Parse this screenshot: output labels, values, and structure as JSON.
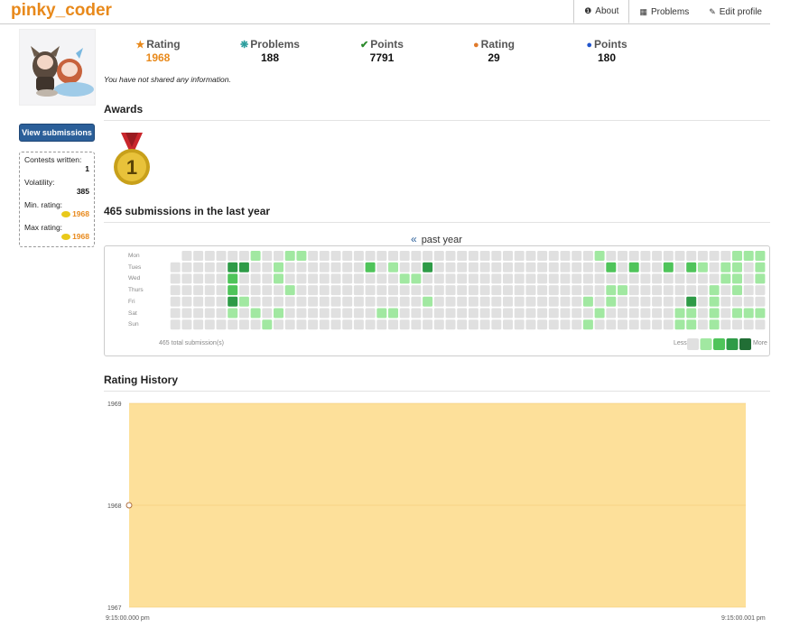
{
  "header": {
    "username": "pinky_coder",
    "tabs": [
      {
        "label": "About",
        "icon": "info-icon",
        "active": true
      },
      {
        "label": "Problems",
        "icon": "sitemap-icon",
        "active": false
      },
      {
        "label": "Edit profile",
        "icon": "edit-icon",
        "active": false
      }
    ]
  },
  "sidebar": {
    "view_submissions": "View submissions",
    "contests_label": "Contests written:",
    "contests_value": "1",
    "volatility_label": "Volatility:",
    "volatility_value": "385",
    "min_label": "Min. rating:",
    "min_value": "1968",
    "max_label": "Max rating:",
    "max_value": "1968"
  },
  "stats": [
    {
      "label": "Rating",
      "value": "1968",
      "icon": "star-icon",
      "icon_color": "#e8891b",
      "value_color": "#e8891b"
    },
    {
      "label": "Problems",
      "value": "188",
      "icon": "puzzle-icon",
      "icon_color": "#2a9d9d",
      "value_color": "#111"
    },
    {
      "label": "Points",
      "value": "7791",
      "icon": "check-icon",
      "icon_color": "#2b8a2b",
      "value_color": "#111"
    },
    {
      "label": "Rating",
      "value": "29",
      "icon": "globe-icon",
      "icon_color": "#e07a2b",
      "value_color": "#111"
    },
    {
      "label": "Points",
      "value": "180",
      "icon": "globe-icon",
      "icon_color": "#2255cc",
      "value_color": "#111"
    }
  ],
  "info_text": "You have not shared any information.",
  "awards": {
    "title": "Awards",
    "medal_number": "1"
  },
  "submissions": {
    "title": "465 submissions in the last year",
    "nav_label": "past year",
    "total_text": "465 total submission(s)",
    "less": "Less",
    "more": "More",
    "days": [
      "Mon",
      "Tues",
      "Wed",
      "Thurs",
      "Fri",
      "Sat",
      "Sun"
    ]
  },
  "rating_history": {
    "title": "Rating History"
  },
  "chart_data": {
    "type": "line",
    "title": "Rating History",
    "x": [
      "9:15:00.000 pm"
    ],
    "xlabels": [
      "9:15:00.000 pm",
      "9:15:00.001 pm"
    ],
    "series": [
      {
        "values": [
          1968
        ]
      }
    ],
    "ylim": [
      1967,
      1969
    ],
    "yticks": [
      1967,
      1968,
      1969
    ],
    "band_color": "#fde09a",
    "grid": true
  },
  "colors": {
    "accent": "#e8891b",
    "button": "#2b5f99",
    "heat": [
      "#e0e0e0",
      "#a1e8a1",
      "#4fc45a",
      "#2e9b47",
      "#216e35"
    ]
  }
}
